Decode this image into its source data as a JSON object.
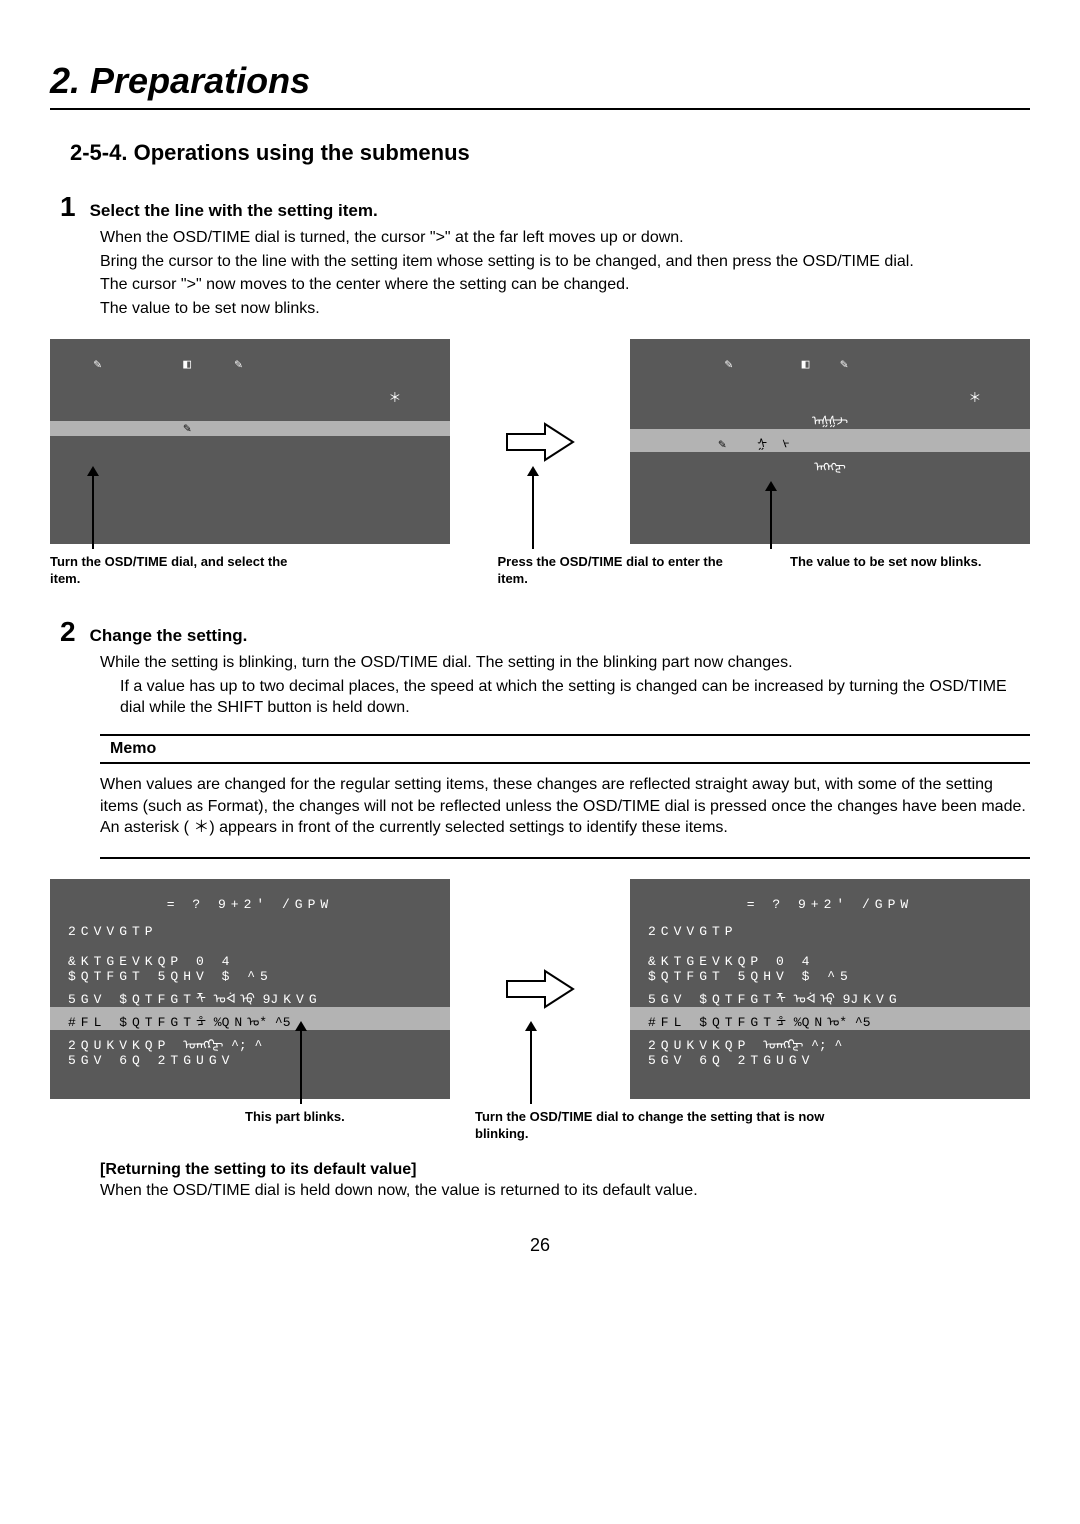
{
  "chapter": "2. Preparations",
  "section": "2-5-4. Operations using the submenus",
  "step1": {
    "num": "1",
    "title": "Select the line with the setting item.",
    "p1": "When the OSD/TIME dial is turned, the cursor \">\" at the far left moves up or down.",
    "p2": "Bring the cursor to the line with the setting item whose setting is to be changed, and then press the OSD/TIME dial.",
    "p3": "The cursor \">\" now moves to the center where the setting can be changed.",
    "p4": "The value to be set now blinks."
  },
  "fig1": {
    "cap_left": "Turn the OSD/TIME dial, and select the item.",
    "cap_mid": "Press the OSD/TIME dial to enter the item.",
    "cap_right": "The value to be set now blinks."
  },
  "step2": {
    "num": "2",
    "title": "Change the setting.",
    "p1": "While the setting is blinking, turn the OSD/TIME dial. The setting in the blinking part now changes.",
    "p2": "If a value has up to two decimal places, the speed at which the setting is changed can be increased by turning the OSD/TIME dial while the SHIFT button is held down."
  },
  "memo": {
    "title": "Memo",
    "p1": "When values are changed for the regular setting items, these changes are reflected straight away but, with some of the setting items (such as Format), the changes will not be reflected unless the OSD/TIME dial is pressed once the changes have been made.",
    "p2": "An asterisk ( ＊) appears in front of the currently selected settings to identify these items."
  },
  "fig2": {
    "menu_title": "= ? 9+2' /GPW",
    "row_pattern": "2CVVGTP",
    "row_direction": "&KTGEVKQP    0 4",
    "row_border_soft": "$QTFGT 5QHV  $   ^5",
    "row_set_border": "5GV $QTFGTᡯ ᠤᢱᡇ 9JKVG",
    "row_fl_border": "#FL $QTFGTᡱ %QNᠣ*  ^5",
    "row_position": "2QUKVKQP  ᠣᠡᡊᡗᡓ  ^;   ^",
    "row_set_preset": "5GV 6Q 2TGUGV",
    "cap_left": "This part blinks.",
    "cap_right": "Turn the OSD/TIME dial to change the setting that is now blinking."
  },
  "returning": {
    "title": "[Returning the setting to its default value]",
    "body": "When the OSD/TIME dial is held down now, the value is returned to its default value."
  },
  "page": "26"
}
